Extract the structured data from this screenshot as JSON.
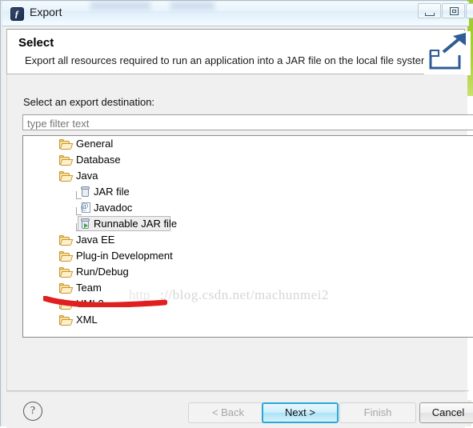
{
  "window": {
    "title": "Export",
    "app_icon": "eclipse-icon",
    "caption_buttons": [
      {
        "name": "minimize-button",
        "glyph": "minimize-icon"
      },
      {
        "name": "maximize-button",
        "glyph": "maximize-icon"
      },
      {
        "name": "close-button",
        "glyph": "close-icon"
      }
    ]
  },
  "banner": {
    "title": "Select",
    "description": "Export all resources required to run an application into a JAR file on the local file system.",
    "icon": "export-arrow-icon"
  },
  "body": {
    "destination_label": "Select an export destination:",
    "filter": {
      "value": "",
      "placeholder": "type filter text"
    },
    "tree": [
      {
        "label": "General",
        "level": 1,
        "icon": "folder-icon",
        "selected": false
      },
      {
        "label": "Database",
        "level": 1,
        "icon": "folder-icon",
        "selected": false
      },
      {
        "label": "Java",
        "level": 1,
        "icon": "folder-icon",
        "selected": false
      },
      {
        "label": "JAR file",
        "level": 2,
        "icon": "jar-icon",
        "selected": false
      },
      {
        "label": "Javadoc",
        "level": 2,
        "icon": "javadoc-icon",
        "selected": false
      },
      {
        "label": "Runnable JAR file",
        "level": 2,
        "icon": "runnable-jar-icon",
        "selected": true
      },
      {
        "label": "Java EE",
        "level": 1,
        "icon": "folder-icon",
        "selected": false
      },
      {
        "label": "Plug-in Development",
        "level": 1,
        "icon": "folder-icon",
        "selected": false
      },
      {
        "label": "Run/Debug",
        "level": 1,
        "icon": "folder-icon",
        "selected": false
      },
      {
        "label": "Team",
        "level": 1,
        "icon": "folder-icon",
        "selected": false
      },
      {
        "label": "UML2",
        "level": 1,
        "icon": "folder-icon",
        "selected": false
      },
      {
        "label": "XML",
        "level": 1,
        "icon": "folder-icon",
        "selected": false
      }
    ]
  },
  "watermark": {
    "prefix": "http",
    "text": "://blog.csdn.net/machunmei2"
  },
  "annotation": {
    "type": "red-underline-stroke",
    "color": "#e02020"
  },
  "footer": {
    "help_label": "?",
    "buttons": [
      {
        "name": "back-button",
        "label": "< Back",
        "state": "disabled"
      },
      {
        "name": "next-button",
        "label": "Next >",
        "state": "default"
      },
      {
        "name": "finish-button",
        "label": "Finish",
        "state": "disabled"
      },
      {
        "name": "cancel-button",
        "label": "Cancel",
        "state": "normal"
      }
    ]
  },
  "colors": {
    "accent": "#2aa8d8",
    "folder": "#fbe2a4",
    "annotation": "#e02020",
    "desktop_strip": "#a9d033"
  }
}
